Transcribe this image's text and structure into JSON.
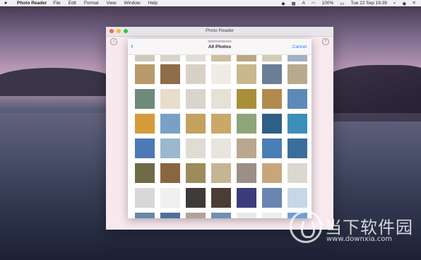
{
  "menubar": {
    "apple": "",
    "app_name": "Photo Reader",
    "menus": [
      "File",
      "Edit",
      "Format",
      "View",
      "Window",
      "Help"
    ],
    "status": {
      "battery": "100%",
      "battery_icon": "▭",
      "date_time": "Tue 22 Sep  19:39"
    }
  },
  "window": {
    "title": "Photo Reader",
    "info_glyph": "i",
    "help_glyph": "?"
  },
  "sheet": {
    "title": "All Photos",
    "back_glyph": "‹",
    "cancel_label": "Cancel"
  },
  "watermark": {
    "cn_text": "当下软件园",
    "url": "www.downxia.com"
  },
  "colors": {
    "accent": "#2a7af3",
    "close": "#fc5f57",
    "minimize": "#fdbc2e",
    "zoom": "#28c840"
  },
  "photos": [
    {
      "c": "#b89a6a"
    },
    {
      "c": "#8f6c4a"
    },
    {
      "c": "#d8d2c6"
    },
    {
      "c": "#f0ece4"
    },
    {
      "c": "#c9b88e"
    },
    {
      "c": "#6c7e94"
    },
    {
      "c": "#b7aa8e"
    },
    {
      "c": "#6e8a7a"
    },
    {
      "c": "#e8dccb"
    },
    {
      "c": "#d9d4cc"
    },
    {
      "c": "#e6e1d6"
    },
    {
      "c": "#a8903a"
    },
    {
      "c": "#b38a4e"
    },
    {
      "c": "#5d89b8"
    },
    {
      "c": "#d59a3c"
    },
    {
      "c": "#7aa0c6"
    },
    {
      "c": "#c3a15f"
    },
    {
      "c": "#caa86a"
    },
    {
      "c": "#8fa57a"
    },
    {
      "c": "#2f5e86"
    },
    {
      "c": "#3d8fb8"
    },
    {
      "c": "#4d79b7"
    },
    {
      "c": "#9ab8cf"
    },
    {
      "c": "#e0dbd3"
    },
    {
      "c": "#e8e4de"
    },
    {
      "c": "#b9a78f"
    },
    {
      "c": "#4a7fb6"
    },
    {
      "c": "#3c6e9c"
    },
    {
      "c": "#6f6a48"
    },
    {
      "c": "#8a6640"
    },
    {
      "c": "#9c8c5c"
    },
    {
      "c": "#c7b493"
    },
    {
      "c": "#9a9088"
    },
    {
      "c": "#c7a77a"
    },
    {
      "c": "#dcd8cf"
    },
    {
      "c": "#d7d7d7"
    },
    {
      "c": "#f0f0f0"
    },
    {
      "c": "#3d3a38"
    },
    {
      "c": "#4a3d36"
    },
    {
      "c": "#3b3c7a"
    },
    {
      "c": "#6a86b0"
    },
    {
      "c": "#c7d7e8"
    },
    {
      "c": "#6688aa"
    },
    {
      "c": "#4f6f9c"
    },
    {
      "c": "#b0a396"
    },
    {
      "c": "#6f8fb8"
    },
    {
      "c": "#eaeaea"
    },
    {
      "c": "#ededed"
    },
    {
      "c": "#6fa0d4"
    }
  ]
}
